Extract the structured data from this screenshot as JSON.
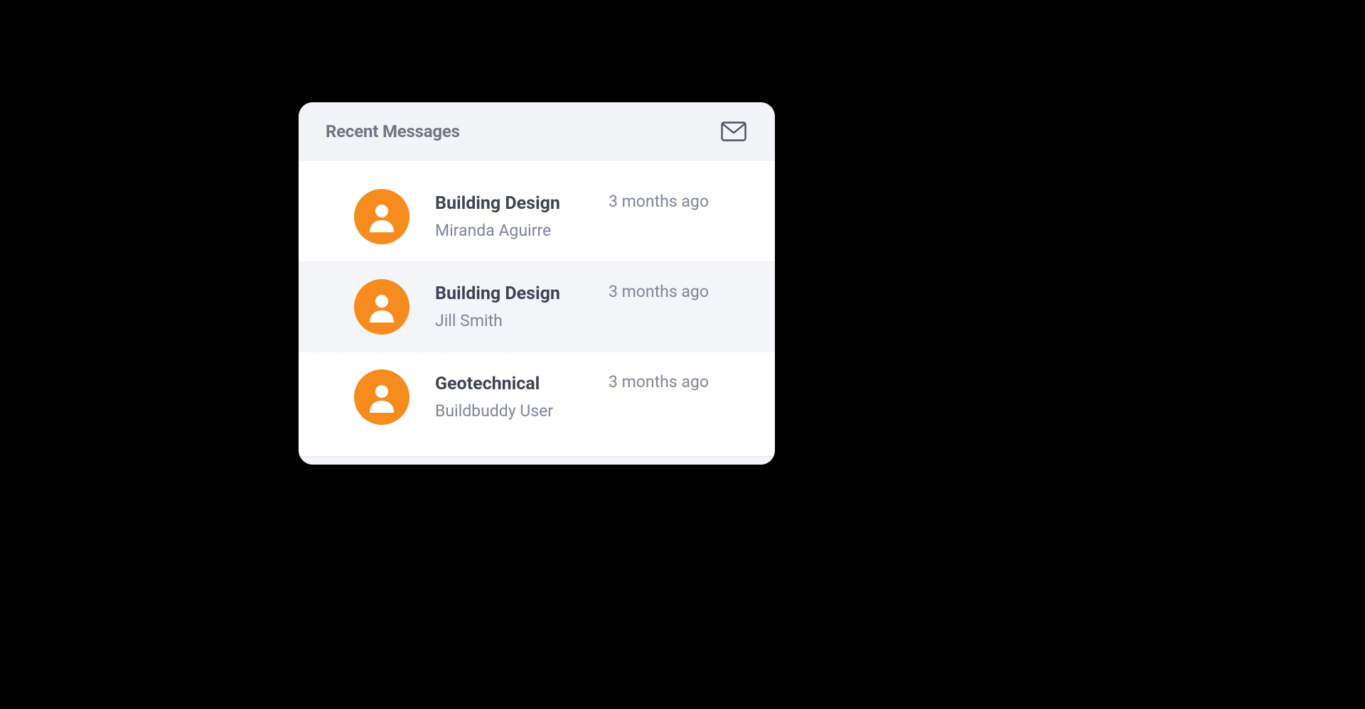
{
  "panel": {
    "title": "Recent Messages",
    "action_icon": "mail-icon"
  },
  "messages": [
    {
      "subject": "Building Design",
      "sender": "Miranda Aguirre",
      "time": "3 months ago",
      "selected": false
    },
    {
      "subject": "Building Design",
      "sender": "Jill Smith",
      "time": "3 months ago",
      "selected": true
    },
    {
      "subject": "Geotechnical",
      "sender": "Buildbuddy User",
      "time": "3 months ago",
      "selected": false
    }
  ],
  "colors": {
    "avatar_bg": "#f68b1e",
    "text_muted": "#7f8499",
    "text_dark": "#3f4455",
    "header_bg": "#f3f4f7"
  }
}
